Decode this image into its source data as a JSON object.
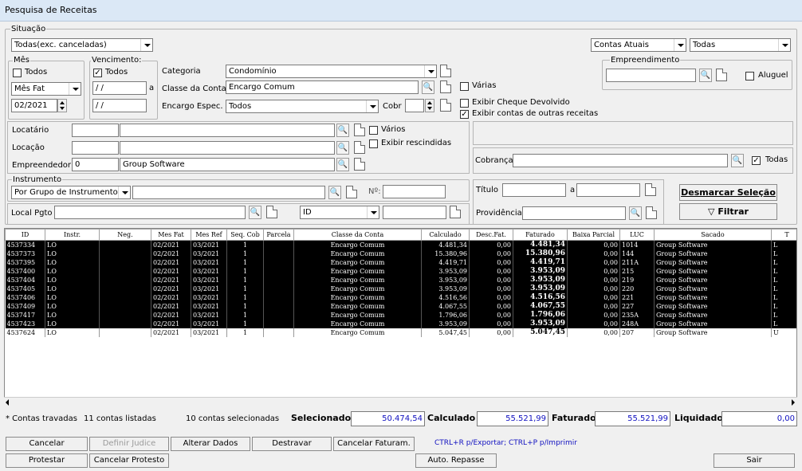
{
  "window_title": "Pesquisa de Receitas",
  "situacao": {
    "legend": "Situação",
    "value": "Todas(exc. canceladas)"
  },
  "contas_atuais": "Contas Atuais",
  "todas_select": "Todas",
  "mes": {
    "legend": "Mês",
    "todos": "Todos",
    "tipo": "Mês Fat",
    "data": "02/2021"
  },
  "vencimento": {
    "legend": "Vencimento:",
    "todos": "Todos",
    "de": " / /",
    "a_label": "a",
    "ate": " / /"
  },
  "categoria": {
    "label": "Categoria",
    "value": "Condomínio"
  },
  "classe": {
    "label": "Classe da Conta",
    "value": "Encargo Comum"
  },
  "encargo": {
    "label": "Encargo Espec.",
    "value": "Todos",
    "cobr_label": "Cobr"
  },
  "varias": "Várias",
  "exibir_cheque": "Exibir Cheque Devolvido",
  "exibir_outras": "Exibir contas de outras receitas",
  "empreendimento": {
    "legend": "Empreendimento",
    "aluguel": "Aluguel"
  },
  "locatario_label": "Locatário",
  "locacao_label": "Locação",
  "empreendedor": {
    "label": "Empreendedor",
    "code": "0",
    "name": "Group Software"
  },
  "varios": "Vários",
  "exibir_rescindidas": "Exibir rescindidas",
  "cobranca": {
    "label": "Cobrança",
    "todas": "Todas"
  },
  "instrumento": {
    "legend": "Instrumento",
    "value": "Por Grupo de Instrumento",
    "n_label": "Nº:"
  },
  "local_pgto": {
    "label": "Local Pgto",
    "field": "ID"
  },
  "titulo": {
    "label": "Título",
    "a_label": "a"
  },
  "providencia_label": "Providência",
  "desmarcar": "Desmarcar Seleção",
  "filtrar": "Filtrar",
  "columns": [
    "ID",
    "Instr.",
    "Neg.",
    "Mes Fat",
    "Mes Ref",
    "Seq. Cob",
    "Parcela",
    "Classe da Conta",
    "Calculado",
    "Desc.Fat.",
    "Faturado",
    "Baixa Parcial",
    "LUC",
    "Sacado",
    "T"
  ],
  "rows": [
    {
      "id": "4537334",
      "instr": "LO",
      "mesfat": "02/2021",
      "mesref": "03/2021",
      "seq": "1",
      "classe": "Encargo Comum",
      "calc": "4.481,34",
      "desc": "0,00",
      "fat": "4.481,34",
      "baixa": "0,00",
      "luc": "1014",
      "sacado": "Group Software",
      "t": "L"
    },
    {
      "id": "4537373",
      "instr": "LO",
      "mesfat": "02/2021",
      "mesref": "03/2021",
      "seq": "1",
      "classe": "Encargo Comum",
      "calc": "15.380,96",
      "desc": "0,00",
      "fat": "15.380,96",
      "baixa": "0,00",
      "luc": "144",
      "sacado": "Group Software",
      "t": "L"
    },
    {
      "id": "4537395",
      "instr": "LO",
      "mesfat": "02/2021",
      "mesref": "03/2021",
      "seq": "1",
      "classe": "Encargo Comum",
      "calc": "4.419,71",
      "desc": "0,00",
      "fat": "4.419,71",
      "baixa": "0,00",
      "luc": "211A",
      "sacado": "Group Software",
      "t": "L"
    },
    {
      "id": "4537400",
      "instr": "LO",
      "mesfat": "02/2021",
      "mesref": "03/2021",
      "seq": "1",
      "classe": "Encargo Comum",
      "calc": "3.953,09",
      "desc": "0,00",
      "fat": "3.953,09",
      "baixa": "0,00",
      "luc": "215",
      "sacado": "Group Software",
      "t": "L"
    },
    {
      "id": "4537404",
      "instr": "LO",
      "mesfat": "02/2021",
      "mesref": "03/2021",
      "seq": "1",
      "classe": "Encargo Comum",
      "calc": "3.953,09",
      "desc": "0,00",
      "fat": "3.953,09",
      "baixa": "0,00",
      "luc": "219",
      "sacado": "Group Software",
      "t": "L"
    },
    {
      "id": "4537405",
      "instr": "LO",
      "mesfat": "02/2021",
      "mesref": "03/2021",
      "seq": "1",
      "classe": "Encargo Comum",
      "calc": "3.953,09",
      "desc": "0,00",
      "fat": "3.953,09",
      "baixa": "0,00",
      "luc": "220",
      "sacado": "Group Software",
      "t": "L"
    },
    {
      "id": "4537406",
      "instr": "LO",
      "mesfat": "02/2021",
      "mesref": "03/2021",
      "seq": "1",
      "classe": "Encargo Comum",
      "calc": "4.516,56",
      "desc": "0,00",
      "fat": "4.516,56",
      "baixa": "0,00",
      "luc": "221",
      "sacado": "Group Software",
      "t": "L"
    },
    {
      "id": "4537409",
      "instr": "LO",
      "mesfat": "02/2021",
      "mesref": "03/2021",
      "seq": "1",
      "classe": "Encargo Comum",
      "calc": "4.067,55",
      "desc": "0,00",
      "fat": "4.067,55",
      "baixa": "0,00",
      "luc": "227",
      "sacado": "Group Software",
      "t": "L"
    },
    {
      "id": "4537417",
      "instr": "LO",
      "mesfat": "02/2021",
      "mesref": "03/2021",
      "seq": "1",
      "classe": "Encargo Comum",
      "calc": "1.796,06",
      "desc": "0,00",
      "fat": "1.796,06",
      "baixa": "0,00",
      "luc": "235A",
      "sacado": "Group Software",
      "t": "L"
    },
    {
      "id": "4537423",
      "instr": "LO",
      "mesfat": "02/2021",
      "mesref": "03/2021",
      "seq": "1",
      "classe": "Encargo Comum",
      "calc": "3.953,09",
      "desc": "0,00",
      "fat": "3.953,09",
      "baixa": "0,00",
      "luc": "248A",
      "sacado": "Group Software",
      "t": "L"
    },
    {
      "id": "4537624",
      "instr": "LO",
      "mesfat": "02/2021",
      "mesref": "03/2021",
      "seq": "1",
      "classe": "Encargo Comum",
      "calc": "5.047,45",
      "desc": "0,00",
      "fat": "5.047,45",
      "baixa": "0,00",
      "luc": "207",
      "sacado": "Group Software",
      "t": "U"
    }
  ],
  "status": {
    "travadas": "* Contas travadas",
    "listadas": "11 contas listadas",
    "selecionadas": "10 contas selecionadas",
    "selecionado_label": "Selecionado",
    "selecionado_value": "50.474,54",
    "calculado_label": "Calculado",
    "calculado_value": "55.521,99",
    "faturado_label": "Faturado",
    "faturado_value": "55.521,99",
    "liquidado_label": "Liquidado",
    "liquidado_value": "0,00"
  },
  "buttons": {
    "cancelar": "Cancelar",
    "definir_judice": "Definir Judice",
    "alterar_dados": "Alterar Dados",
    "destravar": "Destravar",
    "cancelar_faturam": "Cancelar Faturam.",
    "protestar": "Protestar",
    "cancelar_protesto": "Cancelar Protesto",
    "auto_repasse": "Auto. Repasse",
    "sair": "Sair"
  },
  "hint": "CTRL+R p/Exportar; CTRL+P p/Imprimir"
}
